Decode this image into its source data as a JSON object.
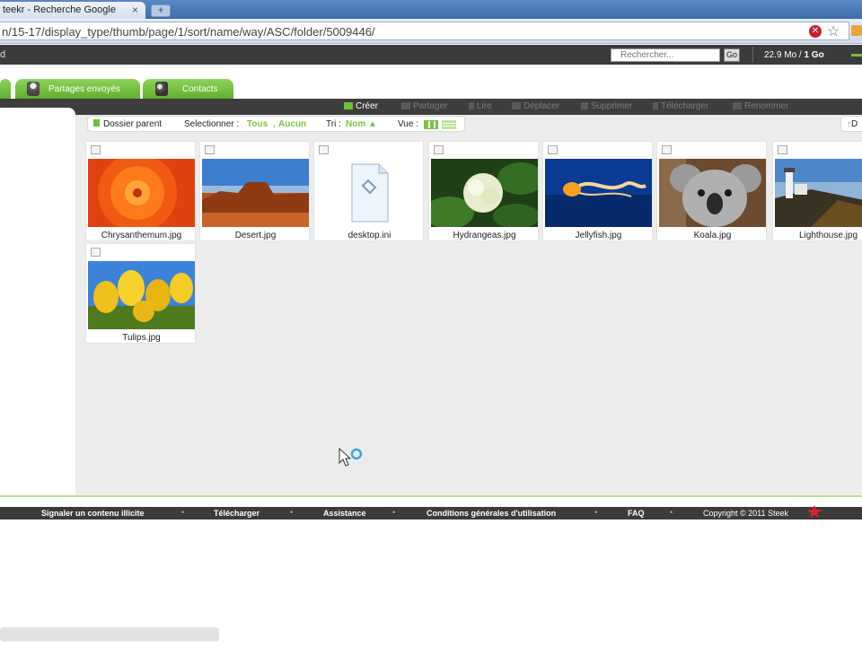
{
  "browser": {
    "tab_title": "teekr - Recherche Google",
    "tab_close": "×",
    "new_tab": "+",
    "url": "n/15-17/display_type/thumb/page/1/sort/name/way/ASC/folder/5009446/"
  },
  "topbar": {
    "left_mark": "d",
    "search_placeholder": "Rechercher...",
    "go_label": "Go",
    "quota_used": "22.9 Mo / ",
    "quota_total": "1 Go"
  },
  "nav_tabs": [
    {
      "label": "Partages envoyés"
    },
    {
      "label": "Contacts"
    }
  ],
  "toolbar": {
    "create": "Créer",
    "share": "Partager",
    "read": "Lire",
    "move": "Déplacer",
    "delete": "Supprimer",
    "download": "Télécharger",
    "rename": "Renommer"
  },
  "options": {
    "parent_folder": "Dossier parent",
    "select_label": "Selectionner :",
    "select_all": "Tous",
    "comma": ",",
    "select_none": "Aucun",
    "sort_label": "Tri :",
    "sort_value": "Nom",
    "sort_arrow": "▲",
    "view_label": "Vue :",
    "corner_arrow": "↑",
    "corner_text": "D"
  },
  "files": [
    {
      "name": "Chrysanthemum.jpg",
      "icon": "photo-chrysanthemum"
    },
    {
      "name": "Desert.jpg",
      "icon": "photo-desert"
    },
    {
      "name": "desktop.ini",
      "icon": "file-icon"
    },
    {
      "name": "Hydrangeas.jpg",
      "icon": "photo-hydrangeas"
    },
    {
      "name": "Jellyfish.jpg",
      "icon": "photo-jellyfish"
    },
    {
      "name": "Koala.jpg",
      "icon": "photo-koala"
    },
    {
      "name": "Lighthouse.jpg",
      "icon": "photo-lighthouse"
    },
    {
      "name": "Tulips.jpg",
      "icon": "photo-tulips"
    }
  ],
  "footer": {
    "report": "Signaler un contenu illicite",
    "download": "Télécharger",
    "help": "Assistance",
    "terms": "Conditions générales d'utilisation",
    "faq": "FAQ",
    "copyright": "Copyright © 2011 Steek"
  },
  "colors": {
    "accent_green": "#6cc13b",
    "dark_bar": "#3b3b3b",
    "content_bg": "#ececec"
  }
}
